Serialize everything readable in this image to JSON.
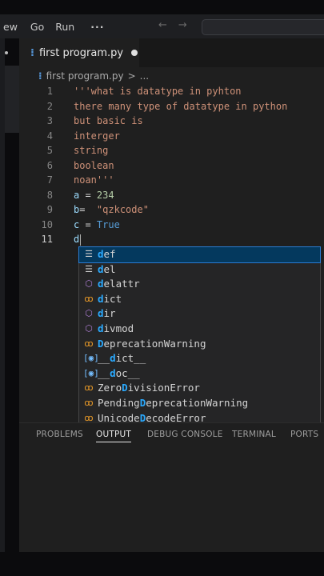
{
  "menubar": {
    "view": "ew",
    "go": "Go",
    "run": "Run",
    "more": "···",
    "back_arrow": "←",
    "forward_arrow": "→"
  },
  "tab": {
    "icon": "python-file-icon",
    "label": "first program.py"
  },
  "breadcrumb": {
    "file": "first program.py",
    "separator": ">",
    "more": "..."
  },
  "code_lines": [
    {
      "n": "1",
      "text": "'''what is datatype in pyhton"
    },
    {
      "n": "2",
      "text": "there many type of datatype in python"
    },
    {
      "n": "3",
      "text": "but basic is"
    },
    {
      "n": "4",
      "text": "interger"
    },
    {
      "n": "5",
      "text": "string"
    },
    {
      "n": "6",
      "text": "boolean"
    },
    {
      "n": "7",
      "text": "noan'''"
    },
    {
      "n": "8",
      "var": "a",
      "op": " = ",
      "val": "234"
    },
    {
      "n": "9",
      "var": "b",
      "op": "=  ",
      "val": "\"qzkcode\""
    },
    {
      "n": "10",
      "var": "c",
      "op": " = ",
      "val": "True"
    },
    {
      "n": "11",
      "var": "d"
    }
  ],
  "suggestions": [
    {
      "match": "d",
      "rest": "ef",
      "kind": "keyword"
    },
    {
      "match": "d",
      "rest": "el",
      "kind": "keyword"
    },
    {
      "match": "d",
      "rest": "elattr",
      "kind": "module"
    },
    {
      "match": "d",
      "rest": "ict",
      "kind": "class"
    },
    {
      "match": "d",
      "rest": "ir",
      "kind": "module"
    },
    {
      "match": "d",
      "rest": "ivmod",
      "kind": "module"
    },
    {
      "pre": "",
      "match": "D",
      "rest": "eprecationWarning",
      "kind": "class"
    },
    {
      "pre": "__",
      "match": "d",
      "rest": "ict__",
      "kind": "variable"
    },
    {
      "pre": "__",
      "match": "d",
      "rest": "oc__",
      "kind": "variable"
    },
    {
      "pre": "Zero",
      "match": "D",
      "rest": "ivisionError",
      "kind": "class"
    },
    {
      "pre": "Pending",
      "match": "D",
      "rest": "eprecationWarning",
      "kind": "class"
    },
    {
      "pre": "Unicode",
      "match": "D",
      "rest": "ecodeError",
      "kind": "class"
    }
  ],
  "panel_tabs": {
    "problems": "PROBLEMS",
    "output": "OUTPUT",
    "debug_console": "DEBUG CONSOLE",
    "terminal": "TERMINAL",
    "ports": "PORTS"
  },
  "colors": {
    "accent_selected": "#04395e",
    "match_highlight": "#2aaaff",
    "string": "#ce9178",
    "variable": "#9cdcfe",
    "number": "#b5cea8",
    "keyword": "#569cd6"
  }
}
